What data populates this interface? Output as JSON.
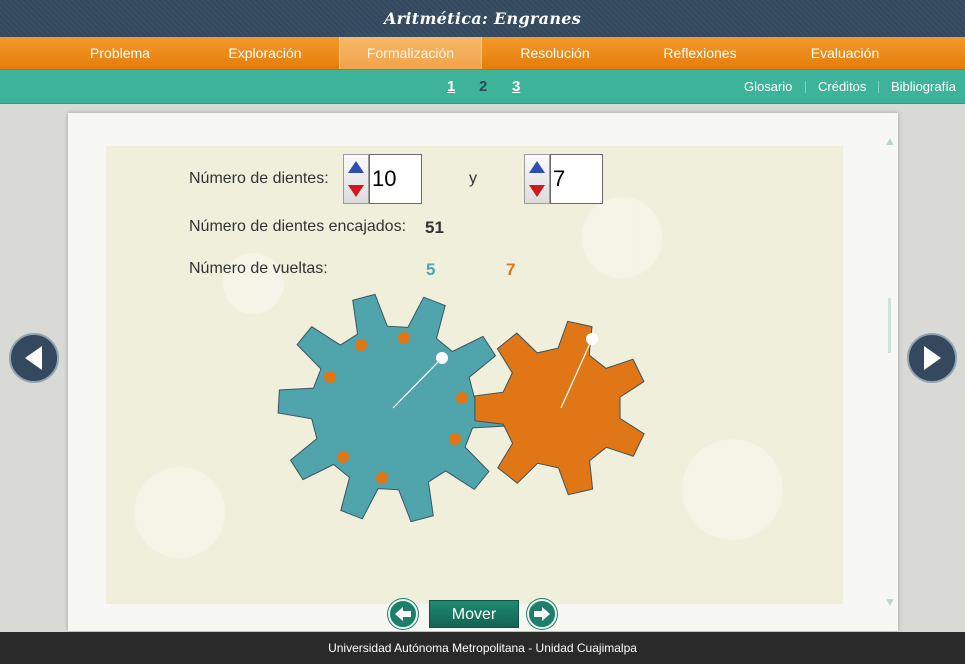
{
  "app": {
    "title": "Aritmética: Engranes"
  },
  "menu": {
    "items": [
      {
        "label": "Problema"
      },
      {
        "label": "Exploración"
      },
      {
        "label": "Formalización"
      },
      {
        "label": "Resolución"
      },
      {
        "label": "Reflexiones"
      },
      {
        "label": "Evaluación"
      }
    ],
    "active": "Formalización"
  },
  "subbar": {
    "pages": [
      "1",
      "2",
      "3"
    ],
    "current_page": "2",
    "links": [
      "Glosario",
      "Créditos",
      "Bibliografía"
    ]
  },
  "form": {
    "teeth_label": "Número de dientes:",
    "teeth_a": "10",
    "connector": "y",
    "teeth_b": "7",
    "meshed_label": "Número de dientes encajados:",
    "meshed_value": "51",
    "turns_label": "Número de vueltas:",
    "turns_a": "5",
    "turns_b": "7"
  },
  "gears": {
    "left": {
      "teeth": 10,
      "color": "#4fa5ab",
      "turns": 5
    },
    "right": {
      "teeth": 7,
      "color": "#e07616",
      "turns": 7
    },
    "marker_color": "#e07616"
  },
  "controls": {
    "move_label": "Mover"
  },
  "icons": {
    "prev": "chevron-left-icon",
    "next": "chevron-right-icon",
    "step_back": "arrow-left-icon",
    "step_forward": "arrow-right-icon"
  },
  "footer": {
    "text": "Universidad Autónoma Metropolitana - Unidad Cuajimalpa"
  }
}
